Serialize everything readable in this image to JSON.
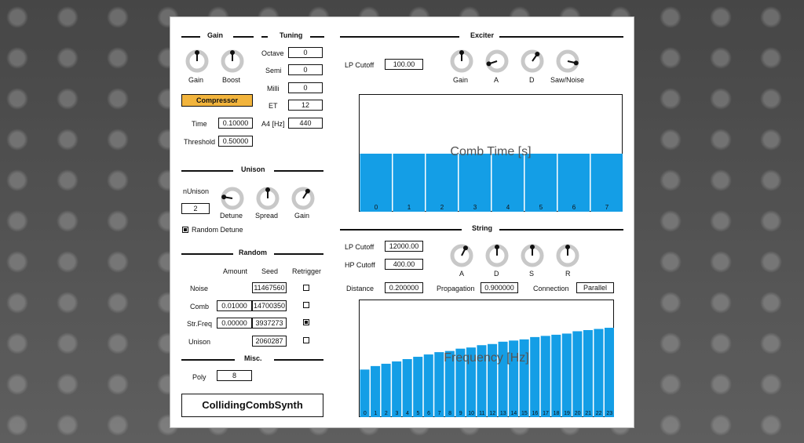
{
  "app_title": "CollidingCombSynth",
  "gain": {
    "header": "Gain",
    "knobs": [
      {
        "label": "Gain",
        "value": 0.5
      },
      {
        "label": "Boost",
        "value": 0.5
      }
    ],
    "compressor_label": "Compressor",
    "time_label": "Time",
    "time_value": "0.10000",
    "threshold_label": "Threshold",
    "threshold_value": "0.50000"
  },
  "tuning": {
    "header": "Tuning",
    "octave_label": "Octave",
    "octave_value": "0",
    "semi_label": "Semi",
    "semi_value": "0",
    "milli_label": "Milli",
    "milli_value": "0",
    "et_label": "ET",
    "et_value": "12",
    "a4_label": "A4 [Hz]",
    "a4_value": "440"
  },
  "unison": {
    "header": "Unison",
    "n_label": "nUnison",
    "n_value": "2",
    "knobs": [
      {
        "label": "Detune",
        "value": 0.2
      },
      {
        "label": "Spread",
        "value": 0.5
      },
      {
        "label": "Gain",
        "value": 0.62
      }
    ],
    "random_detune_label": "Random Detune",
    "random_detune_checked": true
  },
  "random": {
    "header": "Random",
    "col_amount": "Amount",
    "col_seed": "Seed",
    "col_retrigger": "Retrigger",
    "rows": [
      {
        "label": "Noise",
        "amount": "",
        "seed": "11467560",
        "retrigger": false
      },
      {
        "label": "Comb",
        "amount": "0.01000",
        "seed": "14700350",
        "retrigger": false
      },
      {
        "label": "Str.Freq",
        "amount": "0.00000",
        "seed": "3937273",
        "retrigger": true
      },
      {
        "label": "Unison",
        "amount": "",
        "seed": "2060287",
        "retrigger": false
      }
    ]
  },
  "misc": {
    "header": "Misc.",
    "poly_label": "Poly",
    "poly_value": "8"
  },
  "exciter": {
    "header": "Exciter",
    "lp_cutoff_label": "LP Cutoff",
    "lp_cutoff_value": "100.00",
    "knobs": [
      {
        "label": "Gain",
        "value": 0.5
      },
      {
        "label": "A",
        "value": 0.1
      },
      {
        "label": "D",
        "value": 0.63
      },
      {
        "label": "Saw/Noise",
        "value": 0.88
      }
    ],
    "graph_title": "Comb Time [s]",
    "bars": [
      "0",
      "1",
      "2",
      "3",
      "4",
      "5",
      "6",
      "7"
    ],
    "bar_values": [
      0.5,
      0.5,
      0.5,
      0.5,
      0.5,
      0.5,
      0.5,
      0.5
    ]
  },
  "string": {
    "header": "String",
    "lp_cutoff_label": "LP Cutoff",
    "lp_cutoff_value": "12000.00",
    "hp_cutoff_label": "HP Cutoff",
    "hp_cutoff_value": "400.00",
    "knobs": [
      {
        "label": "A",
        "value": 0.6
      },
      {
        "label": "D",
        "value": 0.5
      },
      {
        "label": "S",
        "value": 0.5
      },
      {
        "label": "R",
        "value": 0.5
      }
    ],
    "distance_label": "Distance",
    "distance_value": "0.200000",
    "propagation_label": "Propagation",
    "propagation_value": "0.900000",
    "connection_label": "Connection",
    "connection_value": "Parallel",
    "graph_title": "Frequency [Hz]",
    "bars": [
      "0",
      "1",
      "2",
      "3",
      "4",
      "5",
      "6",
      "7",
      "8",
      "9",
      "10",
      "11",
      "12",
      "13",
      "14",
      "15",
      "16",
      "17",
      "18",
      "19",
      "20",
      "21",
      "22",
      "23"
    ],
    "bar_values": [
      0.41,
      0.44,
      0.46,
      0.48,
      0.5,
      0.52,
      0.54,
      0.56,
      0.57,
      0.59,
      0.6,
      0.62,
      0.63,
      0.65,
      0.66,
      0.67,
      0.69,
      0.7,
      0.71,
      0.72,
      0.74,
      0.75,
      0.76,
      0.77
    ]
  },
  "colors": {
    "accent": "#f2b43c",
    "bar": "#149ee6",
    "knob_ring": "#c8c8c8"
  }
}
